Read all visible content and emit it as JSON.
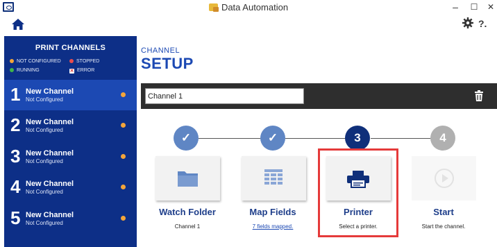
{
  "app": {
    "title": "Data Automation",
    "minimize": "–",
    "maximize": "☐",
    "close": "✕"
  },
  "toolbar": {
    "help": "?."
  },
  "sidebar": {
    "title": "PRINT CHANNELS",
    "legend": {
      "not_configured": "NOT CONFIGURED",
      "stopped": "STOPPED",
      "running": "RUNNING",
      "error": "ERROR"
    },
    "channels": [
      {
        "number": "1",
        "name": "New Channel",
        "status": "Not Configured"
      },
      {
        "number": "2",
        "name": "New Channel",
        "status": "Not Configured"
      },
      {
        "number": "3",
        "name": "New Channel",
        "status": "Not Configured"
      },
      {
        "number": "4",
        "name": "New Channel",
        "status": "Not Configured"
      },
      {
        "number": "5",
        "name": "New Channel",
        "status": "Not Configured"
      }
    ]
  },
  "main": {
    "kicker": "CHANNEL",
    "heading": "SETUP",
    "channel_name": "Channel 1",
    "steps": [
      {
        "marker": "✓",
        "state": "done",
        "label": "Watch Folder",
        "sub": "Channel 1",
        "icon": "folder-icon"
      },
      {
        "marker": "✓",
        "state": "done",
        "label": "Map Fields",
        "sub": "7 fields mapped.",
        "icon": "grid-icon"
      },
      {
        "marker": "3",
        "state": "current",
        "label": "Printer",
        "sub": "Select a printer.",
        "icon": "printer-icon"
      },
      {
        "marker": "4",
        "state": "pending",
        "label": "Start",
        "sub": "Start the channel.",
        "icon": "play-icon"
      }
    ]
  },
  "colors": {
    "navy": "#0d2f87",
    "accent": "#1c49b3",
    "step_done": "#5f86c4",
    "step_current": "#0f2f7a",
    "step_pending": "#b0b0b0",
    "not_configured": "#f4a53a",
    "stopped": "#e84d4d",
    "running": "#3fb54a",
    "highlight": "#e53a3a"
  }
}
